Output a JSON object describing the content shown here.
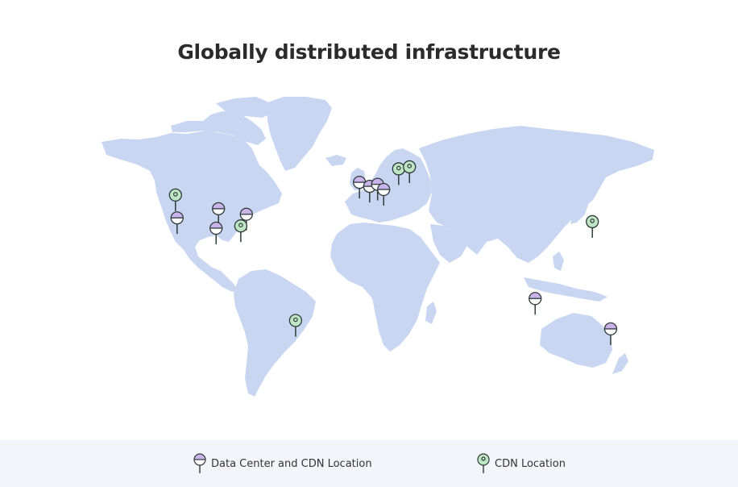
{
  "title": "Globally distributed infrastructure",
  "colors": {
    "land": "#c9d6f1",
    "background": "#ffffff",
    "legend_bg": "#f3f5fb",
    "datacenter_fill": "#c9b3ea",
    "cdn_fill": "#bfe6c4",
    "pin_stroke": "#2f3a3a"
  },
  "legend": {
    "datacenter_label": "Data Center and CDN Location",
    "cdn_label": "CDN Location"
  },
  "markers": [
    {
      "type": "cdn",
      "lon": -122,
      "lat": 47.6
    },
    {
      "type": "datacenter",
      "lon": -121,
      "lat": 37.4
    },
    {
      "type": "datacenter",
      "lon": -95,
      "lat": 41.5
    },
    {
      "type": "datacenter",
      "lon": -96.5,
      "lat": 32.8
    },
    {
      "type": "datacenter",
      "lon": -77.5,
      "lat": 39.0
    },
    {
      "type": "cdn",
      "lon": -81,
      "lat": 33.8
    },
    {
      "type": "cdn",
      "lon": -46.6,
      "lat": -23.5
    },
    {
      "type": "datacenter",
      "lon": -6.5,
      "lat": 53.3
    },
    {
      "type": "datacenter",
      "lon": -0.1,
      "lat": 51.5
    },
    {
      "type": "datacenter",
      "lon": 4.9,
      "lat": 52.4
    },
    {
      "type": "datacenter",
      "lon": 8.7,
      "lat": 50.1
    },
    {
      "type": "cdn",
      "lon": 18.1,
      "lat": 59.3
    },
    {
      "type": "cdn",
      "lon": 24.9,
      "lat": 60.2
    },
    {
      "type": "cdn",
      "lon": 139.7,
      "lat": 35.7
    },
    {
      "type": "datacenter",
      "lon": 103.8,
      "lat": 1.35
    },
    {
      "type": "datacenter",
      "lon": 151.2,
      "lat": -33.9
    }
  ]
}
